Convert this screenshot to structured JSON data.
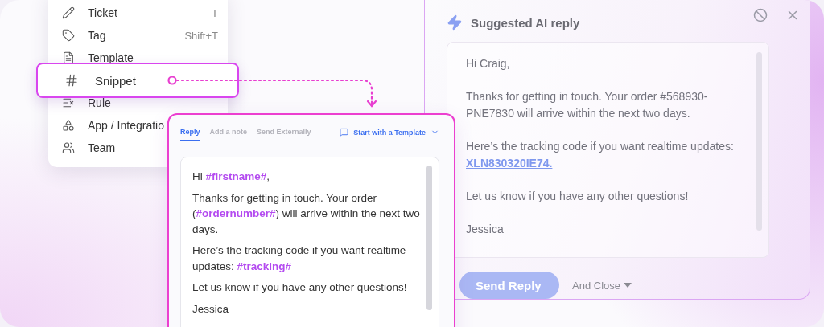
{
  "menu": {
    "items": [
      {
        "label": "Ticket",
        "shortcut": "T",
        "selected": false
      },
      {
        "label": "Tag",
        "shortcut": "Shift+T",
        "selected": false
      },
      {
        "label": "Template",
        "selected": false
      },
      {
        "label": "Snippet",
        "selected": true
      },
      {
        "label": "Rule",
        "selected": false
      },
      {
        "label": "App / Integratio",
        "selected": false
      },
      {
        "label": "Team",
        "selected": false
      }
    ]
  },
  "ai_reply": {
    "title": "Suggested AI reply",
    "paragraphs": [
      {
        "text": "Hi Craig,"
      },
      {
        "text": "Thanks for getting in touch. Your order #568930-PNE7830 will arrive within the next two days."
      },
      {
        "text": "Here’s the tracking code if you want realtime updates: ",
        "link": "XLN830320IE74."
      },
      {
        "text": "Let us know if you have any other questions!"
      },
      {
        "text": "Jessica"
      }
    ],
    "send_button": "Send Reply",
    "close_option": "And Close"
  },
  "composer": {
    "tabs": [
      {
        "label": "Reply",
        "selected": true
      },
      {
        "label": "Add a note",
        "selected": false
      },
      {
        "label": "Send Externally",
        "selected": false
      }
    ],
    "template_button": "Start with a Template",
    "paragraphs": [
      "Hi **#firstname#**,",
      "Thanks for getting in touch. Your order (**#ordernumber#**) will arrive within the next two days.",
      "Here’s the tracking code if you want realtime updates: **#tracking#**",
      "Let us know if you have any other questions!",
      "Jessica"
    ]
  }
}
